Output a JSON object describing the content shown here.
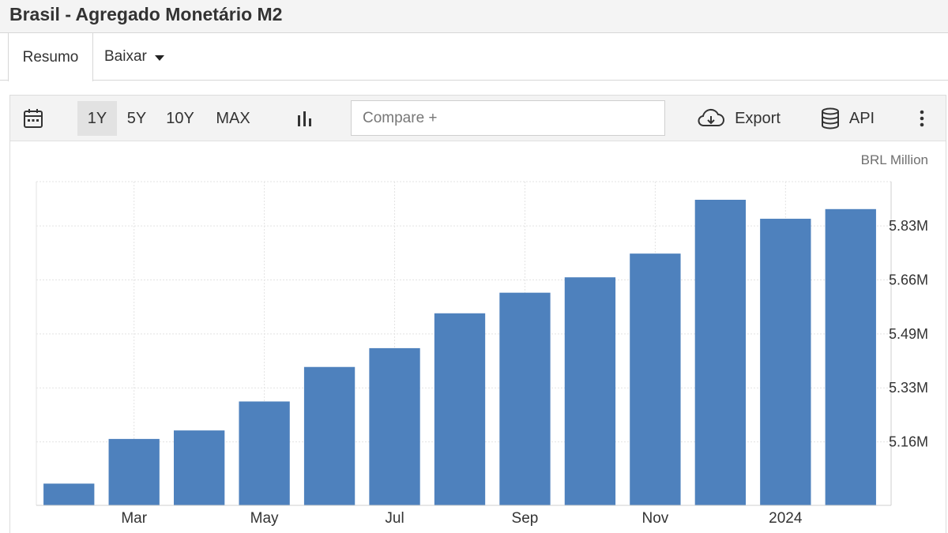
{
  "page": {
    "title": "Brasil - Agregado Monetário M2"
  },
  "tabs": [
    {
      "label": "Resumo"
    },
    {
      "label": "Baixar"
    }
  ],
  "toolbar": {
    "ranges": [
      "1Y",
      "5Y",
      "10Y",
      "MAX"
    ],
    "selected_range": "1Y",
    "compare_placeholder": "Compare +",
    "export_label": "Export",
    "api_label": "API",
    "icons": [
      "calendar-icon",
      "bar-chart-icon",
      "cloud-download-icon",
      "database-icon",
      "more-vertical-icon"
    ]
  },
  "chart_data": {
    "type": "bar",
    "unit": "BRL Million",
    "categories": [
      "Feb 2023",
      "Mar 2023",
      "Apr 2023",
      "May 2023",
      "Jun 2023",
      "Jul 2023",
      "Aug 2023",
      "Sep 2023",
      "Oct 2023",
      "Nov 2023",
      "Dec 2023",
      "Jan 2024",
      "Feb 2024"
    ],
    "values": [
      5.0325,
      5.169,
      5.195,
      5.2835,
      5.389,
      5.4465,
      5.553,
      5.616,
      5.663,
      5.7355,
      5.9,
      5.842,
      5.8715
    ],
    "x_tick_labels": [
      "Mar",
      "May",
      "Jul",
      "Sep",
      "Nov",
      "2024"
    ],
    "y_tick_labels": [
      "5.16M",
      "5.33M",
      "5.49M",
      "5.66M",
      "5.83M"
    ],
    "y_tick_values": [
      5.16,
      5.325,
      5.49,
      5.655,
      5.82
    ],
    "ylim": [
      4.966,
      5.9555
    ],
    "bar_color": "#4e81bd",
    "grid": true,
    "y_axis_side": "right"
  }
}
